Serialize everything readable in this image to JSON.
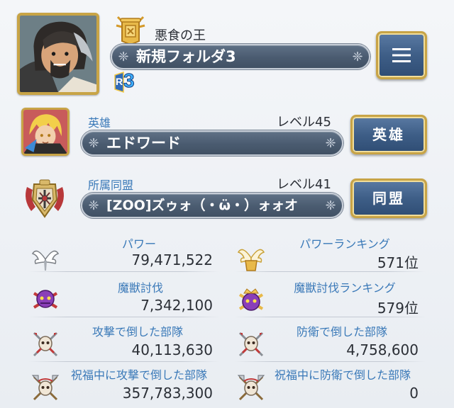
{
  "profile": {
    "title": "悪食の王",
    "name": "新規フォルダ3",
    "rank_prefix": "R",
    "rank_value": "3",
    "menu_icon": "hamburger-icon"
  },
  "hero": {
    "heading": "英雄",
    "level_text": "レベル45",
    "name": "エドワード",
    "button_label": "英雄"
  },
  "alliance": {
    "heading": "所属同盟",
    "level_text": "レベル41",
    "name": "[ZOO]ズゥォ（・ω̈・）ォォオ",
    "button_label": "同盟"
  },
  "stats": [
    {
      "label": "パワー",
      "value": "79,471,522",
      "icon": "wings-icon"
    },
    {
      "label": "パワーランキング",
      "value": "571位",
      "icon": "golden-wings-icon"
    },
    {
      "label": "魔獣討伐",
      "value": "7,342,100",
      "icon": "purple-beast-icon"
    },
    {
      "label": "魔獣討伐ランキング",
      "value": "579位",
      "icon": "crowned-beast-icon"
    },
    {
      "label": "攻撃で倒した部隊",
      "value": "40,113,630",
      "icon": "crossed-swords-skull-icon"
    },
    {
      "label": "防衛で倒した部隊",
      "value": "4,758,600",
      "icon": "crossed-swords-skull-icon"
    },
    {
      "label": "祝福中に攻撃で倒した部隊",
      "value": "357,783,300",
      "icon": "crossed-axes-skull-icon"
    },
    {
      "label": "祝福中に防衛で倒した部隊",
      "value": "0",
      "icon": "crossed-axes-skull-icon"
    }
  ],
  "colors": {
    "label_blue": "#3a79b8",
    "bar_slate": "#4a5b70",
    "button_blue": "#3e5e87",
    "gold_frame": "#c8a446"
  }
}
